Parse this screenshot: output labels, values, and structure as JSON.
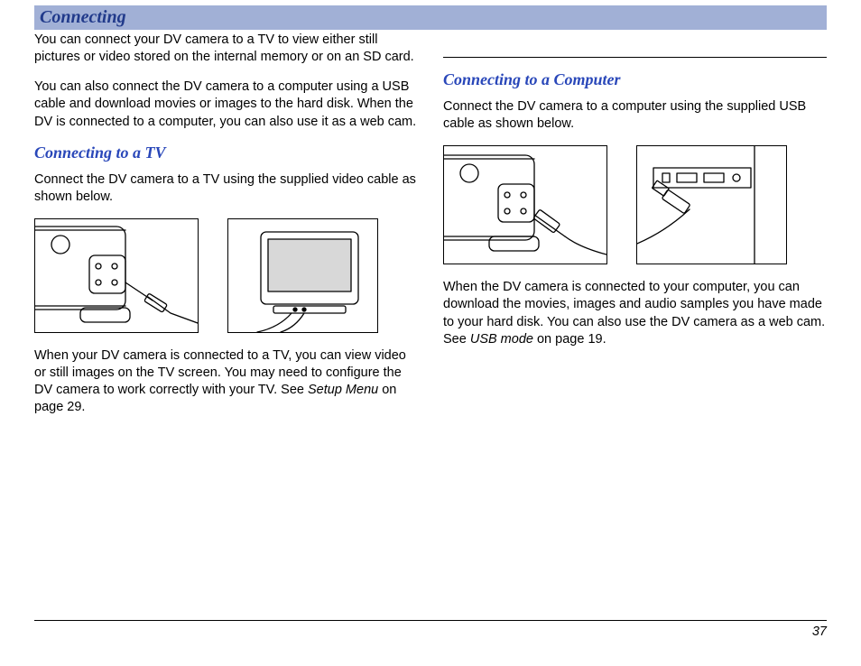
{
  "banner_title": "Connecting",
  "intro_p1": "You can connect your DV camera to a TV to view either still pictures or video stored on the internal memory or on an SD card.",
  "intro_p2": "You can also connect the DV camera to a computer using a USB cable and download movies or images to the hard disk. When the DV is connected to a computer, you can also use it as a web cam.",
  "tv_heading": "Connecting to a TV",
  "tv_p1": "Connect the DV camera to a TV using the supplied video cable as shown below.",
  "tv_p2_a": "When your DV camera is connected to a TV, you can view video or still images on the TV screen. You may need to configure the DV camera to work correctly with your TV. See ",
  "tv_p2_ref": "Setup Menu",
  "tv_p2_b": " on page 29.",
  "comp_heading": "Connecting to a Computer",
  "comp_p1": "Connect the DV camera to a computer using the supplied USB cable as shown below.",
  "comp_p2_a": "When the DV camera is connected to your computer, you can download the movies, images and audio samples you have made to your hard disk. You can also use the DV camera as a web cam. See ",
  "comp_p2_ref": "USB mode",
  "comp_p2_b": " on page 19.",
  "page_number": "37"
}
